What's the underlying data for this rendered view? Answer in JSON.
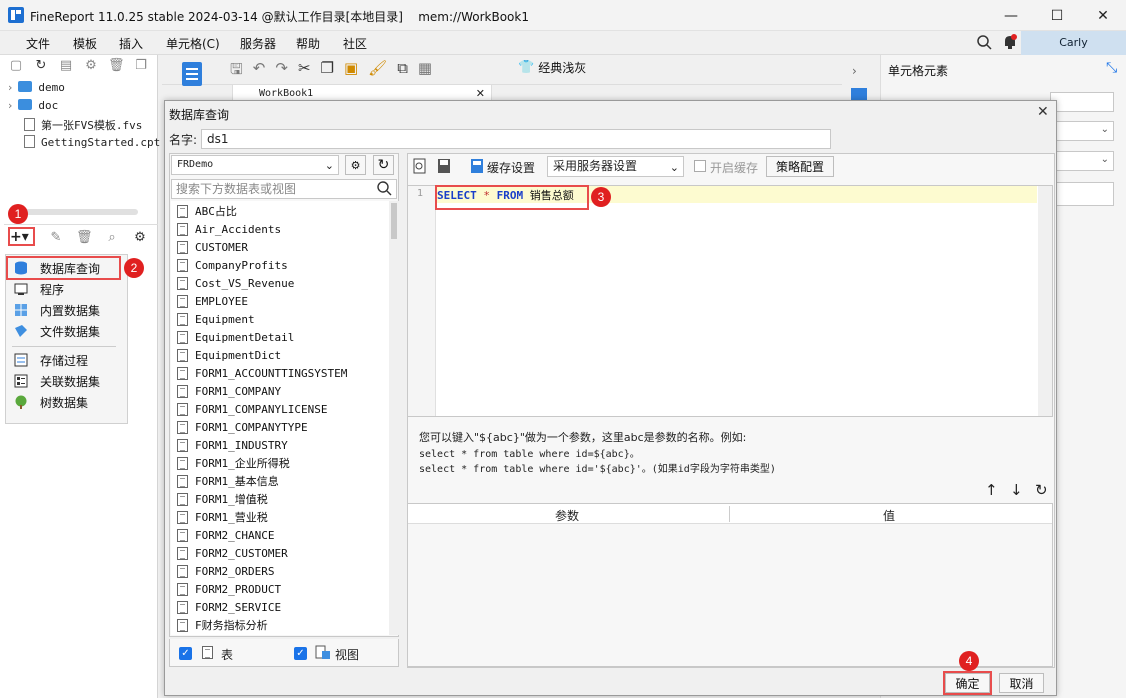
{
  "window": {
    "title": "FineReport 11.0.25 stable 2024-03-14 @默认工作目录[本地目录]    mem://WorkBook1",
    "minimize": "—",
    "maximize": "☐",
    "close": "✕"
  },
  "menubar": {
    "items": [
      "文件",
      "模板",
      "插入",
      "单元格(C)",
      "服务器",
      "帮助",
      "社区"
    ],
    "user": "Carly"
  },
  "sidebar": {
    "tree": [
      {
        "label": "demo",
        "type": "folder"
      },
      {
        "label": "doc",
        "type": "folder"
      },
      {
        "label": "第一张FVS模板.fvs",
        "type": "file"
      },
      {
        "label": "GettingStarted.cpt",
        "type": "file"
      }
    ],
    "add_button": "+▾",
    "dataset_menu": [
      "数据库查询",
      "程序",
      "内置数据集",
      "文件数据集",
      "存储过程",
      "关联数据集",
      "树数据集"
    ]
  },
  "designer": {
    "style_label": "经典浅灰",
    "tab": "WorkBook1",
    "right_panel_title": "单元格元素"
  },
  "dialog": {
    "title": "数据库查询",
    "name_label": "名字:",
    "name_value": "ds1",
    "connection": "FRDemo",
    "search_placeholder": "搜索下方数据表或视图",
    "tables": [
      "ABC占比",
      "Air_Accidents",
      "CUSTOMER",
      "CompanyProfits",
      "Cost_VS_Revenue",
      "EMPLOYEE",
      "Equipment",
      "EquipmentDetail",
      "EquipmentDict",
      "FORM1_ACCOUNTTINGSYSTEM",
      "FORM1_COMPANY",
      "FORM1_COMPANYLICENSE",
      "FORM1_COMPANYTYPE",
      "FORM1_INDUSTRY",
      "FORM1_企业所得税",
      "FORM1_基本信息",
      "FORM1_增值税",
      "FORM1_营业税",
      "FORM2_CHANCE",
      "FORM2_CUSTOMER",
      "FORM2_ORDERS",
      "FORM2_PRODUCT",
      "FORM2_SERVICE",
      "F财务指标分析"
    ],
    "filter_table": "表",
    "filter_view": "视图",
    "cache_label": "缓存设置",
    "cache_select": "采用服务器设置",
    "enable_cache": "开启缓存",
    "strategy_button": "策略配置",
    "sql": {
      "line": "1",
      "kw1": "SELECT",
      "star": "*",
      "kw2": "FROM",
      "table": "销售总额"
    },
    "hint": [
      "您可以键入\"${abc}\"做为一个参数，这里abc是参数的名称。例如:",
      "select * from table where id=${abc}。",
      "select * from table where id='${abc}'。(如果id字段为字符串类型)"
    ],
    "param_header": "参数",
    "value_header": "值",
    "ok": "确定",
    "cancel": "取消"
  },
  "badges": [
    "1",
    "2",
    "3",
    "4"
  ],
  "colors": {
    "accent": "#1a73e8",
    "badge": "#e02020",
    "highlight_line": "#fdfbd0",
    "keyword": "#1a3fc9"
  }
}
